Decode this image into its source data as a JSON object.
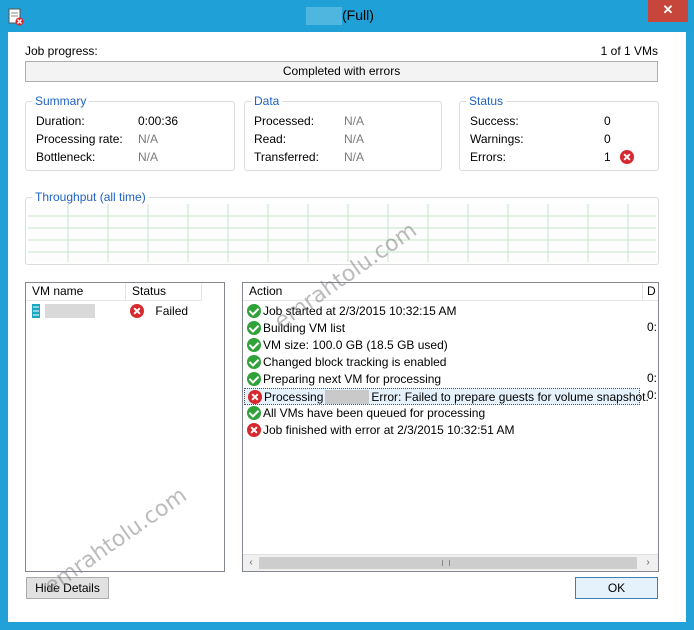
{
  "window": {
    "title_suffix": "(Full)",
    "close_glyph": "✕"
  },
  "job": {
    "progress_label": "Job progress:",
    "vm_count": "1 of 1 VMs",
    "progress_status": "Completed with errors"
  },
  "summary": {
    "title": "Summary",
    "duration_label": "Duration:",
    "duration_value": "0:00:36",
    "rate_label": "Processing rate:",
    "rate_value": "N/A",
    "bottleneck_label": "Bottleneck:",
    "bottleneck_value": "N/A"
  },
  "data_group": {
    "title": "Data",
    "processed_label": "Processed:",
    "processed_value": "N/A",
    "read_label": "Read:",
    "read_value": "N/A",
    "transferred_label": "Transferred:",
    "transferred_value": "N/A"
  },
  "status": {
    "title": "Status",
    "success_label": "Success:",
    "success_value": "0",
    "warnings_label": "Warnings:",
    "warnings_value": "0",
    "errors_label": "Errors:",
    "errors_value": "1"
  },
  "throughput": {
    "title": "Throughput (all time)"
  },
  "vm_list": {
    "col_name": "VM name",
    "col_status": "Status",
    "rows": [
      {
        "name": "",
        "status": "Failed",
        "icon": "error-icon"
      }
    ]
  },
  "action_list": {
    "col_action": "Action",
    "col_duration": "D",
    "rows": [
      {
        "icon": "success-icon",
        "text": "Job started at 2/3/2015 10:32:15 AM",
        "duration": ""
      },
      {
        "icon": "success-icon",
        "text": "Building VM list",
        "duration": "0:"
      },
      {
        "icon": "success-icon",
        "text": "VM size: 100.0 GB (18.5 GB used)",
        "duration": ""
      },
      {
        "icon": "success-icon",
        "text": "Changed block tracking is enabled",
        "duration": ""
      },
      {
        "icon": "success-icon",
        "text": "Preparing next VM for processing",
        "duration": "0:"
      },
      {
        "icon": "error-icon",
        "text_prefix": "Processing",
        "text_suffix": "Error: Failed to prepare guests for volume snapshot.",
        "duration": "0:"
      },
      {
        "icon": "success-icon",
        "text": "All VMs have been queued for processing",
        "duration": ""
      },
      {
        "icon": "error-icon",
        "text": "Job finished with error at 2/3/2015 10:32:51 AM",
        "duration": ""
      }
    ]
  },
  "buttons": {
    "hide_details": "Hide Details",
    "ok": "OK"
  },
  "watermark": "emrahtolu.com",
  "colors": {
    "titlebar": "#1fa0d7",
    "group_title": "#1f62c4",
    "success": "#2fa23a",
    "error": "#d7282e"
  }
}
